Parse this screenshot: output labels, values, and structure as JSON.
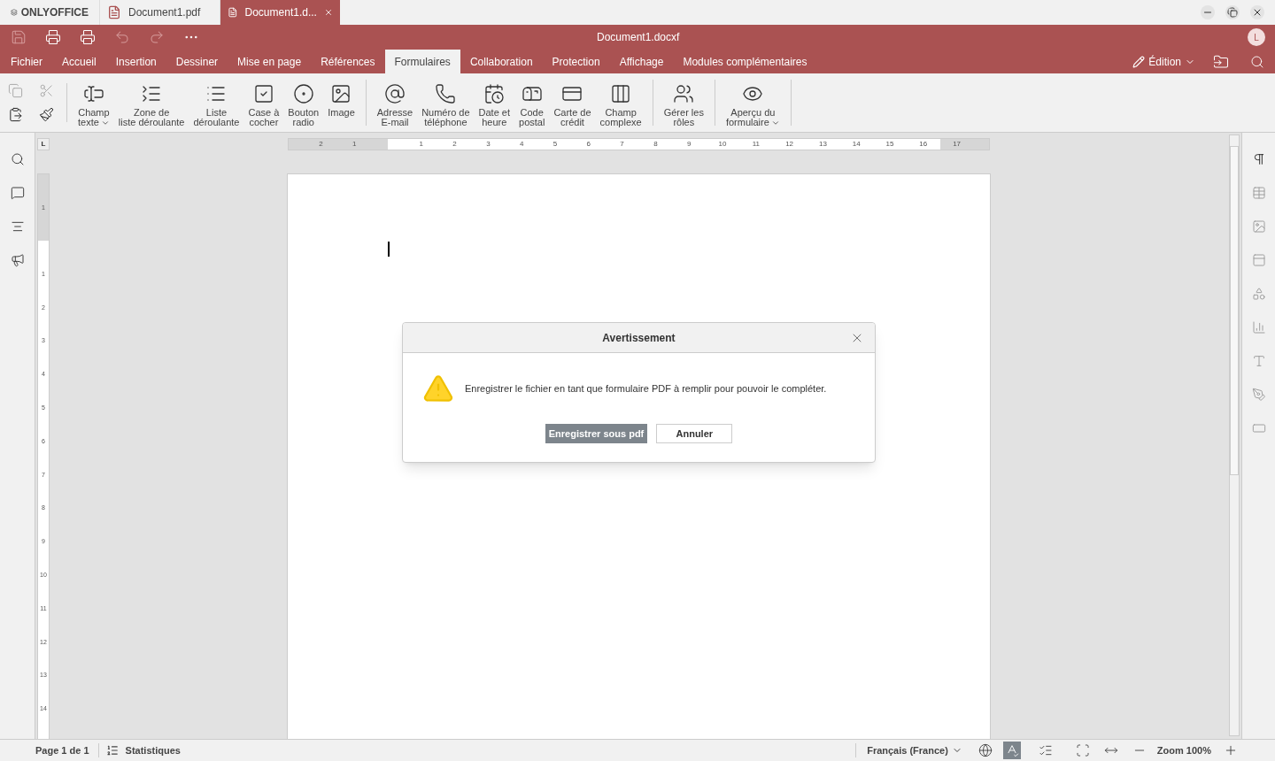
{
  "app_tabs": {
    "brand": "ONLYOFFICE",
    "tabs": [
      {
        "label": "Document1.pdf",
        "selected": false,
        "closable": false
      },
      {
        "label": "Document1.d...",
        "selected": true,
        "closable": true
      }
    ]
  },
  "quick_access": [
    {
      "disabled": true
    },
    {
      "disabled": false
    },
    {
      "disabled": false
    },
    {
      "disabled": true
    },
    {
      "disabled": true
    },
    {
      "disabled": false
    }
  ],
  "window": {
    "title": "Document1.docxf",
    "avatar": "L"
  },
  "menu": [
    {
      "label": "Fichier",
      "selected": false
    },
    {
      "label": "Accueil",
      "selected": false
    },
    {
      "label": "Insertion",
      "selected": false
    },
    {
      "label": "Dessiner",
      "selected": false
    },
    {
      "label": "Mise en page",
      "selected": false
    },
    {
      "label": "Références",
      "selected": false
    },
    {
      "label": "Formulaires",
      "selected": true
    },
    {
      "label": "Collaboration",
      "selected": false
    },
    {
      "label": "Protection",
      "selected": false
    },
    {
      "label": "Affichage",
      "selected": false
    },
    {
      "label": "Modules complémentaires",
      "selected": false
    }
  ],
  "mode": {
    "label": "Édition"
  },
  "clipboard": [
    {
      "disabled": true
    },
    {
      "disabled": true
    },
    {
      "disabled": false
    },
    {
      "disabled": false
    }
  ],
  "ribbon_groups": [
    [
      {
        "lines": [
          "Champ",
          "texte"
        ],
        "dropdown": true
      },
      {
        "lines": [
          "Zone de",
          "liste déroulante"
        ],
        "dropdown": false
      },
      {
        "lines": [
          "Liste",
          "déroulante"
        ],
        "dropdown": false
      },
      {
        "lines": [
          "Case à",
          "cocher"
        ],
        "dropdown": false
      },
      {
        "lines": [
          "Bouton",
          "radio"
        ],
        "dropdown": false
      },
      {
        "lines": [
          "Image"
        ],
        "dropdown": false
      }
    ],
    [
      {
        "lines": [
          "Adresse",
          "E-mail"
        ],
        "dropdown": false
      },
      {
        "lines": [
          "Numéro de",
          "téléphone"
        ],
        "dropdown": false
      },
      {
        "lines": [
          "Date et",
          "heure"
        ],
        "dropdown": false
      },
      {
        "lines": [
          "Code",
          "postal"
        ],
        "dropdown": false
      },
      {
        "lines": [
          "Carte de",
          "crédit"
        ],
        "dropdown": false
      },
      {
        "lines": [
          "Champ",
          "complexe"
        ],
        "dropdown": false
      }
    ],
    [
      {
        "lines": [
          "Gérer les",
          "rôles"
        ],
        "dropdown": false
      }
    ],
    [
      {
        "lines": [
          "Aperçu du",
          "formulaire"
        ],
        "dropdown": true
      }
    ]
  ],
  "ruler": {
    "corner": "L",
    "h_labels": [
      "2",
      "1",
      "1",
      "2",
      "3",
      "4",
      "5",
      "6",
      "7",
      "8",
      "9",
      "10",
      "11",
      "12",
      "13",
      "14",
      "15",
      "16",
      "17"
    ],
    "v_labels": [
      "1",
      "1",
      "2",
      "3",
      "4",
      "5",
      "6",
      "7",
      "8",
      "9",
      "10",
      "11",
      "12",
      "13",
      "14"
    ]
  },
  "dialog": {
    "title": "Avertissement",
    "message": "Enregistrer le fichier en tant que formulaire PDF à remplir pour pouvoir le compléter.",
    "buttons": [
      {
        "label": "Enregistrer sous pdf",
        "primary": true
      },
      {
        "label": "Annuler",
        "primary": false
      }
    ]
  },
  "status_bar": {
    "page": "Page 1 de 1",
    "stats": "Statistiques",
    "language": "Français (France)",
    "spellcheck_on": true,
    "zoom": "Zoom 100%"
  }
}
